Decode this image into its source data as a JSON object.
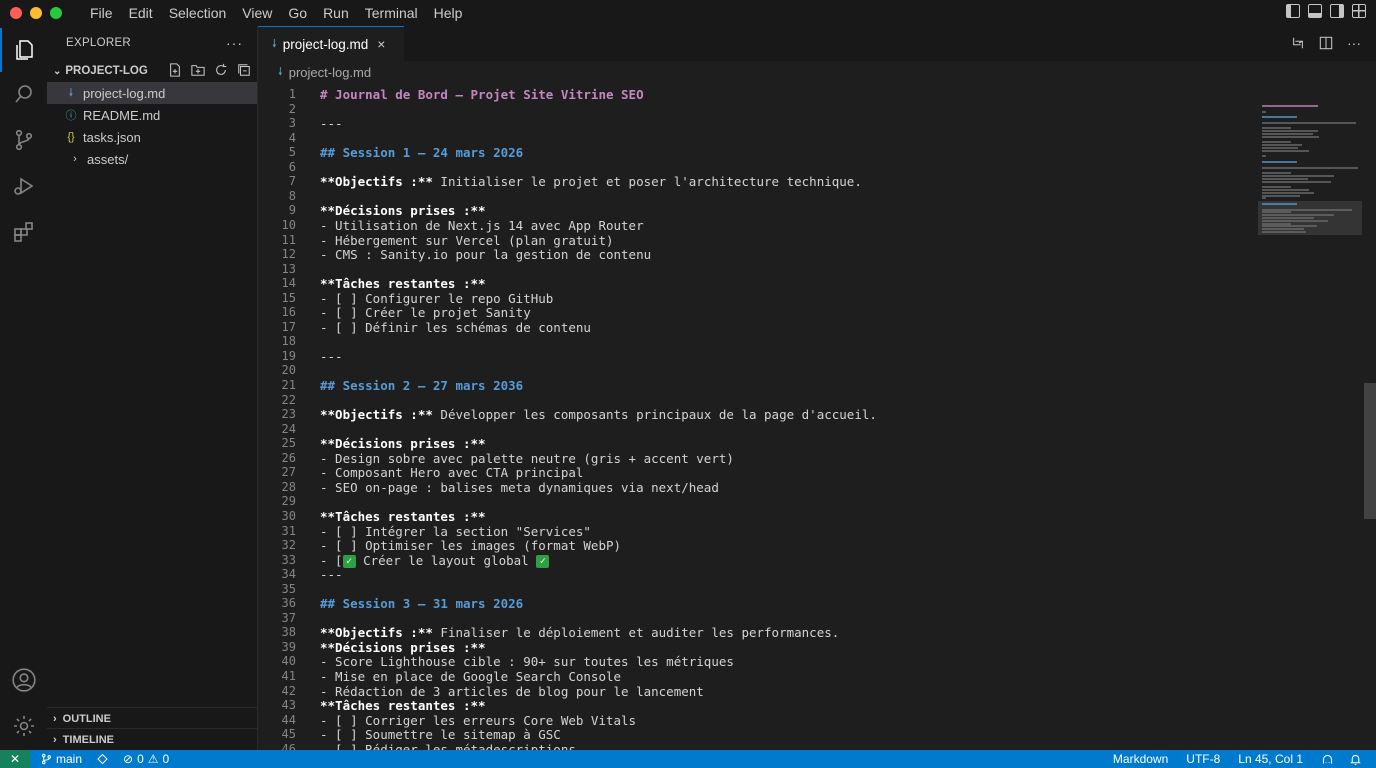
{
  "menu": [
    "File",
    "Edit",
    "Selection",
    "View",
    "Go",
    "Run",
    "Terminal",
    "Help"
  ],
  "colors": {
    "accent": "#0078d4",
    "statusbar": "#007acc",
    "h1": "#c586c0",
    "h2": "#569cd6",
    "remote": "#16825d",
    "check": "#2ea043"
  },
  "sidebar": {
    "title": "EXPLORER",
    "more": "···",
    "folder": "PROJECT-LOG",
    "files": [
      {
        "name": "project-log.md",
        "icon": "markdown-icon",
        "glyph": "🠗"
      },
      {
        "name": "README.md",
        "icon": "info-icon",
        "glyph": "ⓘ"
      },
      {
        "name": "tasks.json",
        "icon": "json-icon",
        "glyph": "{}"
      },
      {
        "name": "assets/",
        "icon": "chevron-right-icon",
        "glyph": "›"
      }
    ],
    "outline": "OUTLINE",
    "timeline": "TIMELINE"
  },
  "editor": {
    "tab": "project-log.md",
    "tab_close": "×",
    "breadcrumb": "project-log.md",
    "lines": [
      [
        {
          "t": "# Journal de Bord – Projet Site Vitrine SEO",
          "c": "h1"
        }
      ],
      [],
      [
        {
          "t": "---"
        }
      ],
      [],
      [
        {
          "t": "## Session 1 — 24 mars 2026",
          "c": "h2"
        }
      ],
      [],
      [
        {
          "t": "**Objectifs :**",
          "c": "bold"
        },
        {
          "t": " Initialiser le projet et poser l'architecture technique."
        }
      ],
      [],
      [
        {
          "t": "**Décisions prises :**",
          "c": "bold"
        }
      ],
      [
        {
          "t": "- Utilisation de Next.js 14 avec App Router"
        }
      ],
      [
        {
          "t": "- Hébergement sur Vercel (plan gratuit)"
        }
      ],
      [
        {
          "t": "- CMS : Sanity.io pour la gestion de contenu"
        }
      ],
      [],
      [
        {
          "t": "**Tâches restantes :**",
          "c": "bold"
        }
      ],
      [
        {
          "t": "- [ ] Configurer le repo GitHub"
        }
      ],
      [
        {
          "t": "- [ ] Créer le projet Sanity"
        }
      ],
      [
        {
          "t": "- [ ] Définir les schémas de contenu"
        }
      ],
      [],
      [
        {
          "t": "---"
        }
      ],
      [],
      [
        {
          "t": "## Session 2 — 27 mars 2036",
          "c": "h2"
        }
      ],
      [],
      [
        {
          "t": "**Objectifs :**",
          "c": "bold"
        },
        {
          "t": " Développer les composants principaux de la page d'accueil."
        }
      ],
      [],
      [
        {
          "t": "**Décisions prises :**",
          "c": "bold"
        }
      ],
      [
        {
          "t": "- Design sobre avec palette neutre (gris + accent vert)"
        }
      ],
      [
        {
          "t": "- Composant Hero avec CTA principal"
        }
      ],
      [
        {
          "t": "- SEO on-page : balises meta dynamiques via next/head"
        }
      ],
      [],
      [
        {
          "t": "**Tâches restantes :**",
          "c": "bold"
        }
      ],
      [
        {
          "t": "- [ ] Intégrer la section \"Services\""
        }
      ],
      [
        {
          "t": "- [ ] Optimiser les images (format WebP)"
        }
      ],
      [
        {
          "t": "- [",
          "c": ""
        },
        {
          "t": "✓",
          "c": "check"
        },
        {
          "t": " Créer le layout global "
        },
        {
          "t": "✓",
          "c": "check"
        }
      ],
      [
        {
          "t": "---"
        }
      ],
      [],
      [
        {
          "t": "## Session 3 — 31 mars 2026",
          "c": "h2"
        }
      ],
      [],
      [
        {
          "t": "**Objectifs :**",
          "c": "bold"
        },
        {
          "t": " Finaliser le déploiement et auditer les performances."
        }
      ],
      [
        {
          "t": "**Décisions prises :**",
          "c": "bold"
        }
      ],
      [
        {
          "t": "- Score Lighthouse cible : 90+ sur toutes les métriques"
        }
      ],
      [
        {
          "t": "- Mise en place de Google Search Console"
        }
      ],
      [
        {
          "t": "- Rédaction de 3 articles de blog pour le lancement"
        }
      ],
      [
        {
          "t": "**Tâches restantes :**",
          "c": "bold"
        }
      ],
      [
        {
          "t": "- [ ] Corriger les erreurs Core Web Vitals"
        }
      ],
      [
        {
          "t": "- [ ] Soumettre le sitemap à GSC"
        }
      ],
      [
        {
          "t": "- [ ] Rédiger les métadescriptions"
        }
      ],
      []
    ]
  },
  "statusbar": {
    "remote": "✕",
    "branch": "main",
    "errors": "0",
    "warnings": "0",
    "language": "Markdown",
    "encoding": "UTF-8",
    "position": "Ln 45, Col 1"
  }
}
